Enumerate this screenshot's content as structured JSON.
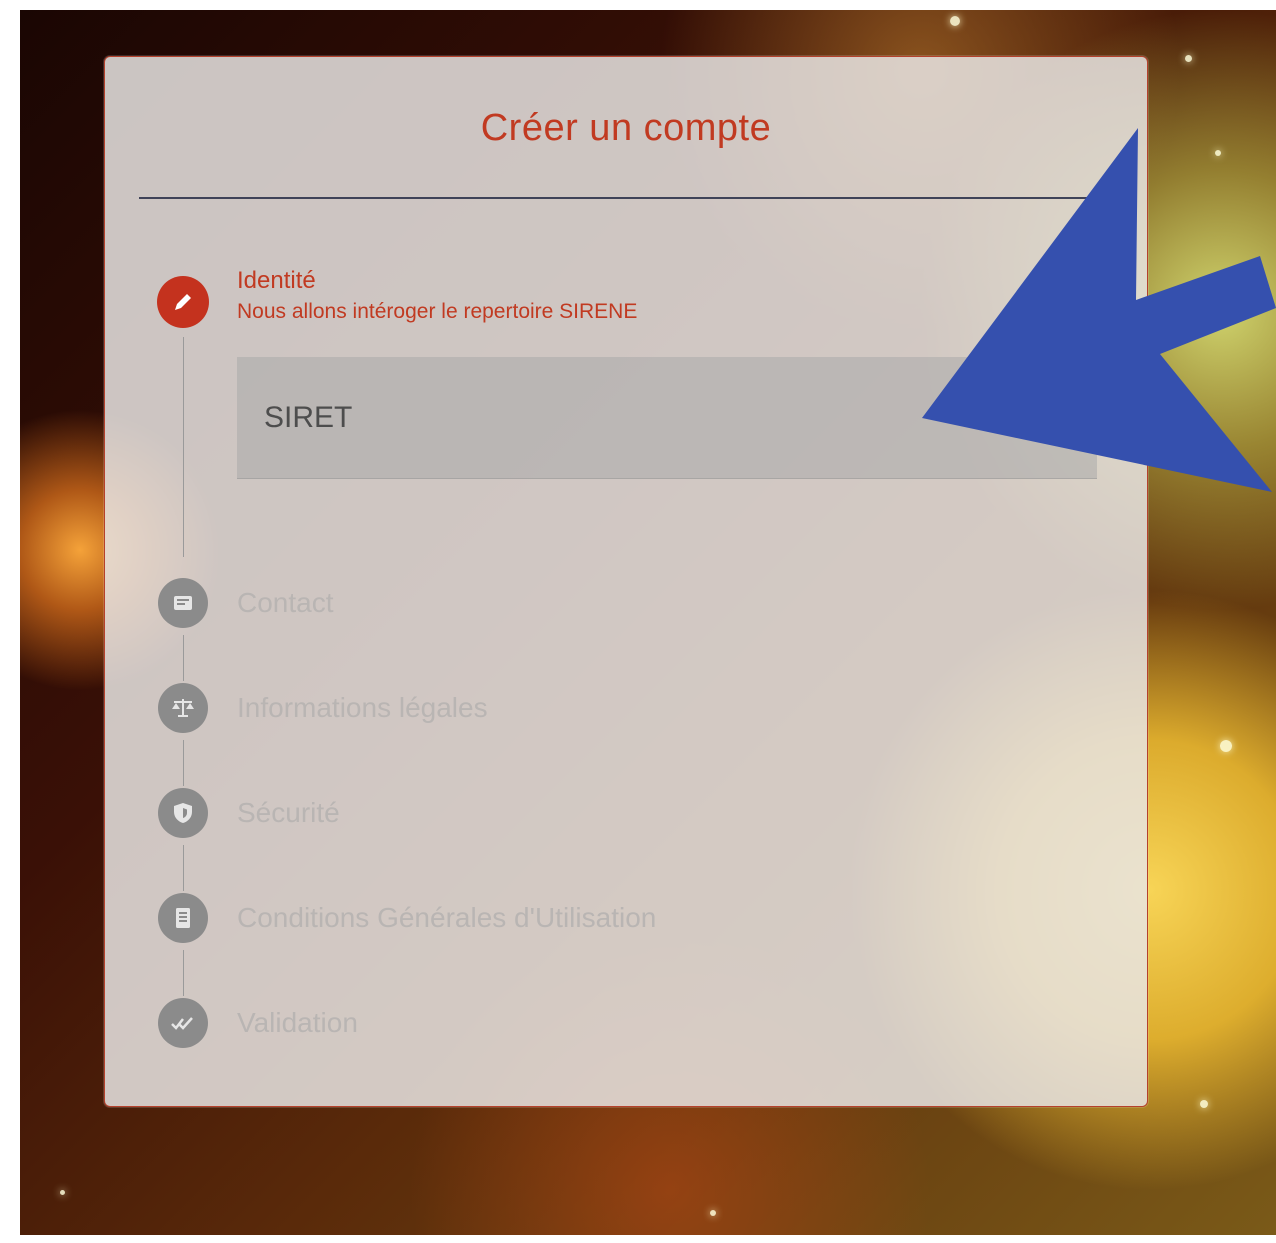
{
  "card": {
    "title": "Créer un compte"
  },
  "stepper": {
    "active_step": {
      "label": "Identité",
      "subtitle": "Nous allons intéroger le repertoire SIRENE",
      "icon": "pencil-icon",
      "input": {
        "placeholder": "SIRET",
        "value": ""
      }
    },
    "steps": [
      {
        "label": "Contact",
        "icon": "contact-card-icon"
      },
      {
        "label": "Informations légales",
        "icon": "balance-scale-icon"
      },
      {
        "label": "Sécurité",
        "icon": "shield-icon"
      },
      {
        "label": "Conditions Générales d'Utilisation",
        "icon": "document-icon"
      },
      {
        "label": "Validation",
        "icon": "double-check-icon"
      }
    ]
  },
  "colors": {
    "accent": "#c4321e",
    "annotation_arrow": "#3550ae",
    "inactive_icon": "#8b8b8b"
  }
}
